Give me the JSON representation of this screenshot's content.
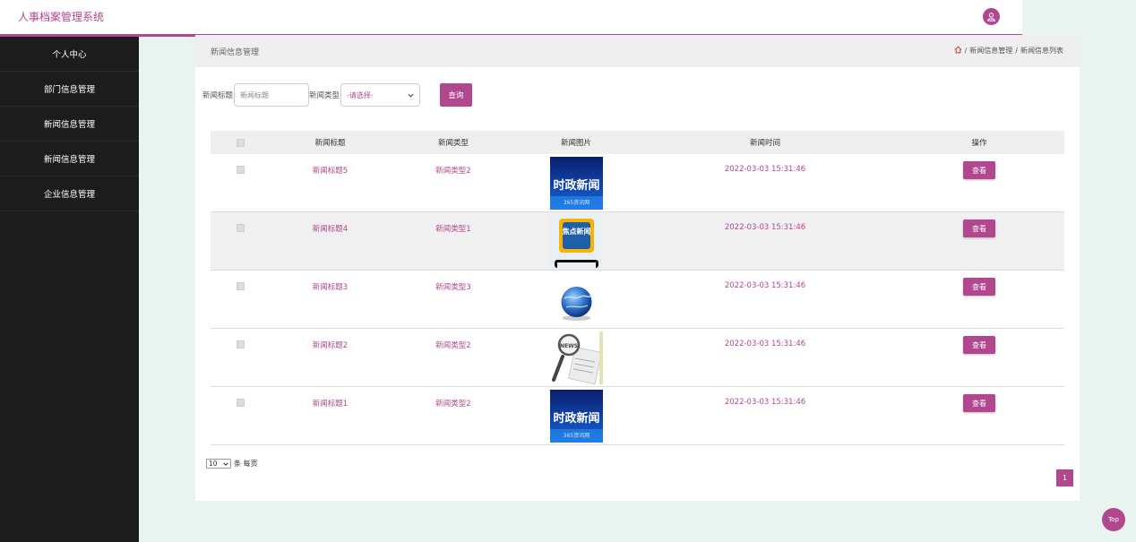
{
  "app": {
    "title": "人事档案管理系统"
  },
  "sidebar": {
    "items": [
      {
        "label": "个人中心"
      },
      {
        "label": "部门信息管理"
      },
      {
        "label": "新闻信息管理"
      },
      {
        "label": "新闻信息管理"
      },
      {
        "label": "企业信息管理"
      }
    ]
  },
  "panel": {
    "title": "新闻信息管理",
    "breadcrumb": {
      "sep": "/",
      "level1": "新闻信息管理",
      "level2": "新闻信息列表"
    }
  },
  "search": {
    "title_label": "新闻标题",
    "title_placeholder": "新闻标题",
    "type_label": "新闻类型",
    "type_selected": "-请选择-",
    "query_button": "查询"
  },
  "table": {
    "headers": {
      "title": "新闻标题",
      "type": "新闻类型",
      "image": "新闻图片",
      "time": "新闻时间",
      "action": "操作"
    },
    "rows": [
      {
        "title": "新闻标题5",
        "type": "新闻类型2",
        "image": "news-thumb-politics",
        "time": "2022-03-03 15:31:46",
        "action": "查看"
      },
      {
        "title": "新闻标题4",
        "type": "新闻类型1",
        "image": "news-thumb-hot",
        "time": "2022-03-03 15:31:46",
        "action": "查看"
      },
      {
        "title": "新闻标题3",
        "type": "新闻类型3",
        "image": "news-thumb-globe",
        "time": "2022-03-03 15:31:46",
        "action": "查看"
      },
      {
        "title": "新闻标题2",
        "type": "新闻类型2",
        "image": "news-thumb-magnifier",
        "time": "2022-03-03 15:31:46",
        "action": "查看"
      },
      {
        "title": "新闻标题1",
        "type": "新闻类型2",
        "image": "news-thumb-politics",
        "time": "2022-03-03 15:31:46",
        "action": "查看"
      }
    ]
  },
  "thumbs": {
    "politics_main": "时政新闻",
    "politics_sub": "365资讯网",
    "hot": "焦点新闻",
    "magnifier": "NEWS"
  },
  "pagination": {
    "page_size": "10",
    "per_page_label": "条 每页",
    "current_page": "1"
  },
  "back_to_top": "Top",
  "colors": {
    "accent": "#b1488f",
    "sidebar": "#1c1c1c",
    "background": "#e9f3ef"
  }
}
